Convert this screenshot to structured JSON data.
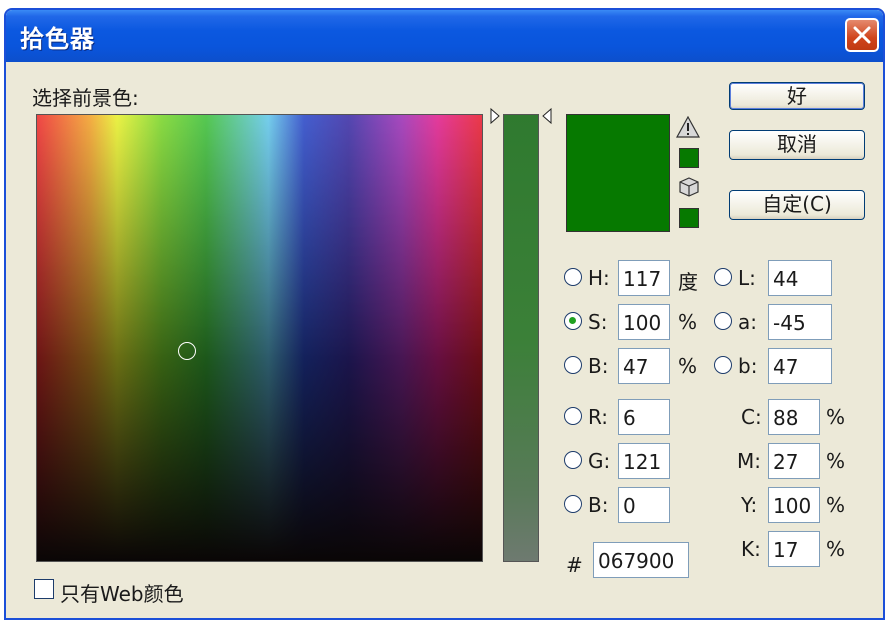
{
  "window": {
    "title": "拾色器"
  },
  "picker": {
    "heading": "选择前景色:"
  },
  "buttons": {
    "ok": "好",
    "cancel": "取消",
    "custom": "自定(C)"
  },
  "current_color": "#067900",
  "fields": {
    "h": {
      "label": "H:",
      "value": "117",
      "unit": "度"
    },
    "s": {
      "label": "S:",
      "value": "100",
      "unit": "%"
    },
    "bri": {
      "label": "B:",
      "value": "47",
      "unit": "%"
    },
    "r": {
      "label": "R:",
      "value": "6"
    },
    "g": {
      "label": "G:",
      "value": "121"
    },
    "blue": {
      "label": "B:",
      "value": "0"
    },
    "l": {
      "label": "L:",
      "value": "44"
    },
    "a": {
      "label": "a:",
      "value": "-45"
    },
    "lab_b": {
      "label": "b:",
      "value": "47"
    },
    "c": {
      "label": "C:",
      "value": "88",
      "unit": "%"
    },
    "m": {
      "label": "M:",
      "value": "27",
      "unit": "%"
    },
    "y": {
      "label": "Y:",
      "value": "100",
      "unit": "%"
    },
    "k": {
      "label": "K:",
      "value": "17",
      "unit": "%"
    },
    "hex": {
      "label": "#",
      "value": "067900"
    }
  },
  "options": {
    "web_only": "只有Web颜色",
    "web_only_checked": false
  },
  "selected_mode": "S",
  "icons": [
    "close-icon",
    "gamut-warning-icon",
    "web-safe-cube-icon"
  ]
}
